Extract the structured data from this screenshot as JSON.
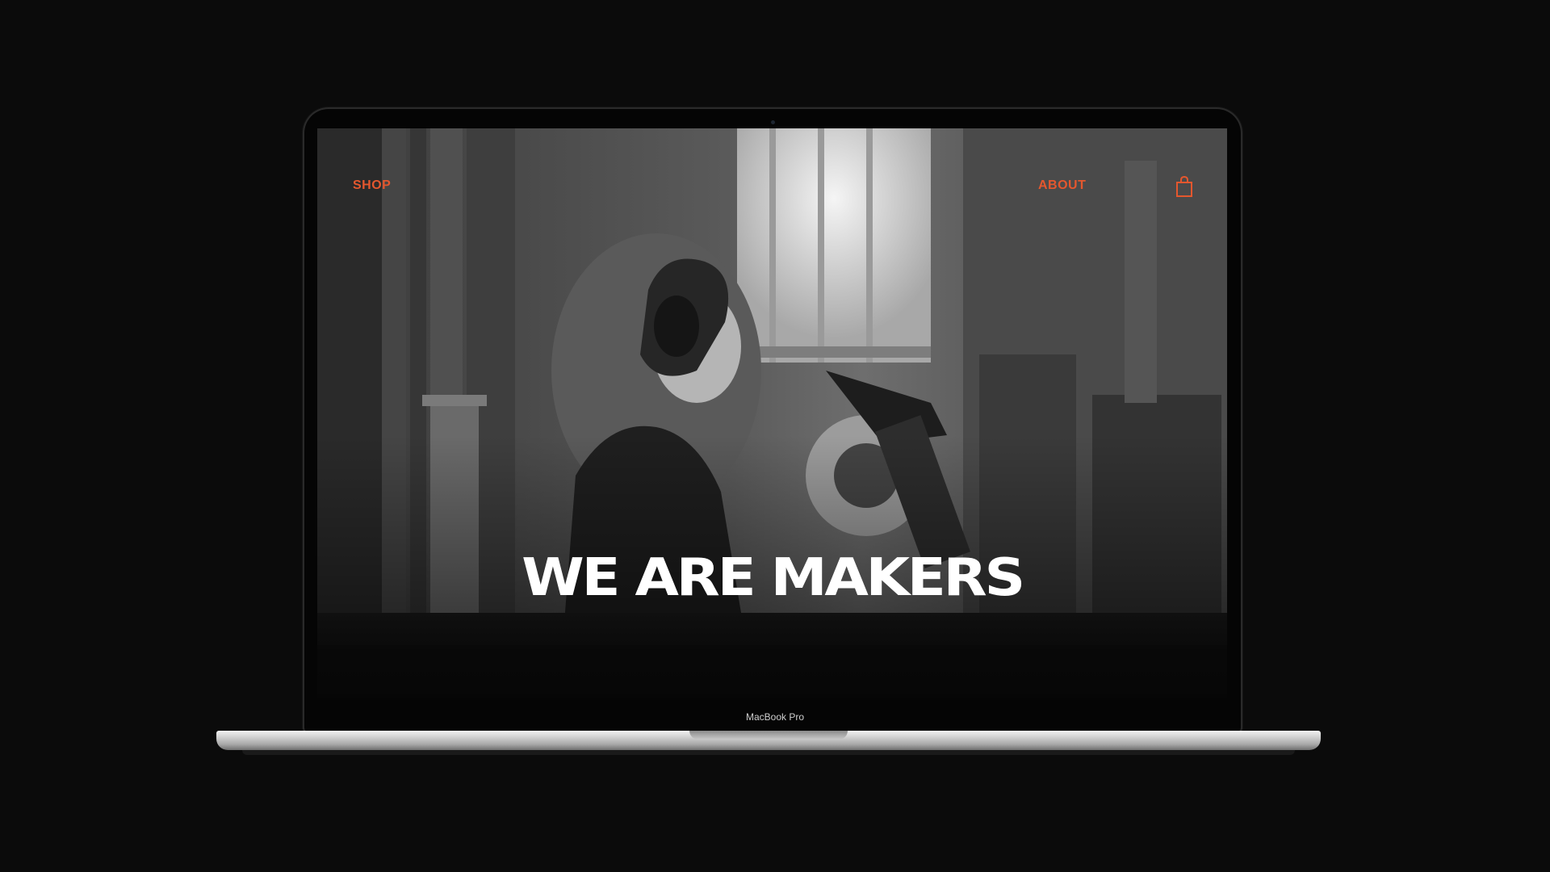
{
  "nav": {
    "shop_label": "SHOP",
    "about_label": "ABOUT",
    "cart_icon": "shopping-bag-icon"
  },
  "hero": {
    "title": "WE ARE MAKERS",
    "image_description_icon": "workshop-photo"
  },
  "device": {
    "model_label": "MacBook Pro"
  },
  "colors": {
    "accent": "#e4572e",
    "background": "#0b0b0b",
    "hero_text": "#ffffff"
  }
}
